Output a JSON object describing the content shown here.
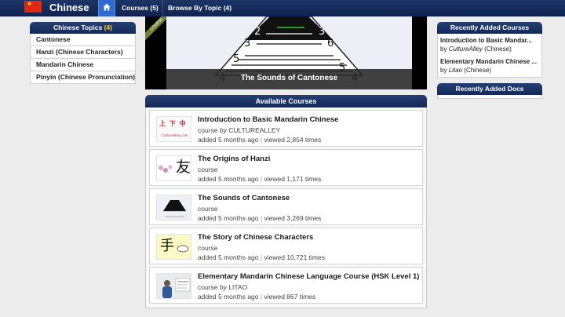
{
  "header": {
    "brand": "Chinese",
    "flag_icon": "china-flag-icon",
    "home_icon": "home-icon",
    "nav": [
      {
        "label": "Courses (5)"
      },
      {
        "label": "Browse By Topic (4)"
      }
    ]
  },
  "topics": {
    "title": "Chinese Topics",
    "count": "(4)",
    "items": [
      {
        "label": "Cantonese"
      },
      {
        "label": "Hanzi (Chinese Characters)"
      },
      {
        "label": "Mandarin Chinese"
      },
      {
        "label": "Pinyin (Chinese Pronunciation)"
      }
    ]
  },
  "banner": {
    "ribbon": "COURSE",
    "caption": "The Sounds of Cantonese",
    "tone_numbers": [
      "2",
      "3",
      "3",
      "6",
      "5",
      "5",
      "4",
      "4"
    ]
  },
  "available": {
    "title": "Available Courses",
    "courses": [
      {
        "title": "Introduction to Basic Mandarin Chinese",
        "type": "course",
        "by": "by",
        "author": "CULTUREALLEY",
        "added": "added 5 months ago",
        "viewed": "viewed 2,854 times",
        "thumb_text": "上 下 中",
        "thumb_caption": "CultureAlley.com"
      },
      {
        "title": "The Origins of Hanzi",
        "type": "course",
        "by": "",
        "author": "",
        "added": "added 5 months ago",
        "viewed": "viewed 1,171 times",
        "thumb_text": "友"
      },
      {
        "title": "The Sounds of Cantonese",
        "type": "course",
        "by": "",
        "author": "",
        "added": "added 5 months ago",
        "viewed": "viewed 3,269 times",
        "thumb_text": ""
      },
      {
        "title": "The Story of Chinese Characters",
        "type": "course",
        "by": "",
        "author": "",
        "added": "added 5 months ago",
        "viewed": "viewed 10,721 times",
        "thumb_text": "手"
      },
      {
        "title": "Elementary Mandarin Chinese Language Course (HSK Level 1)",
        "type": "course",
        "by": "by",
        "author": "LITAO",
        "added": "added 5 months ago",
        "viewed": "viewed 867 times",
        "thumb_text": ""
      }
    ],
    "separator": "|"
  },
  "recent_courses": {
    "title": "Recently Added Courses",
    "items": [
      {
        "title": "Introduction to Basic Mandar...",
        "by": "by",
        "author": "CultureAlley",
        "lang": "(Chinese)"
      },
      {
        "title": "Elementary Mandarin Chinese ...",
        "by": "by",
        "author": "Litao",
        "lang": "(Chinese)"
      }
    ]
  },
  "recent_docs": {
    "title": "Recently Added Docs"
  }
}
